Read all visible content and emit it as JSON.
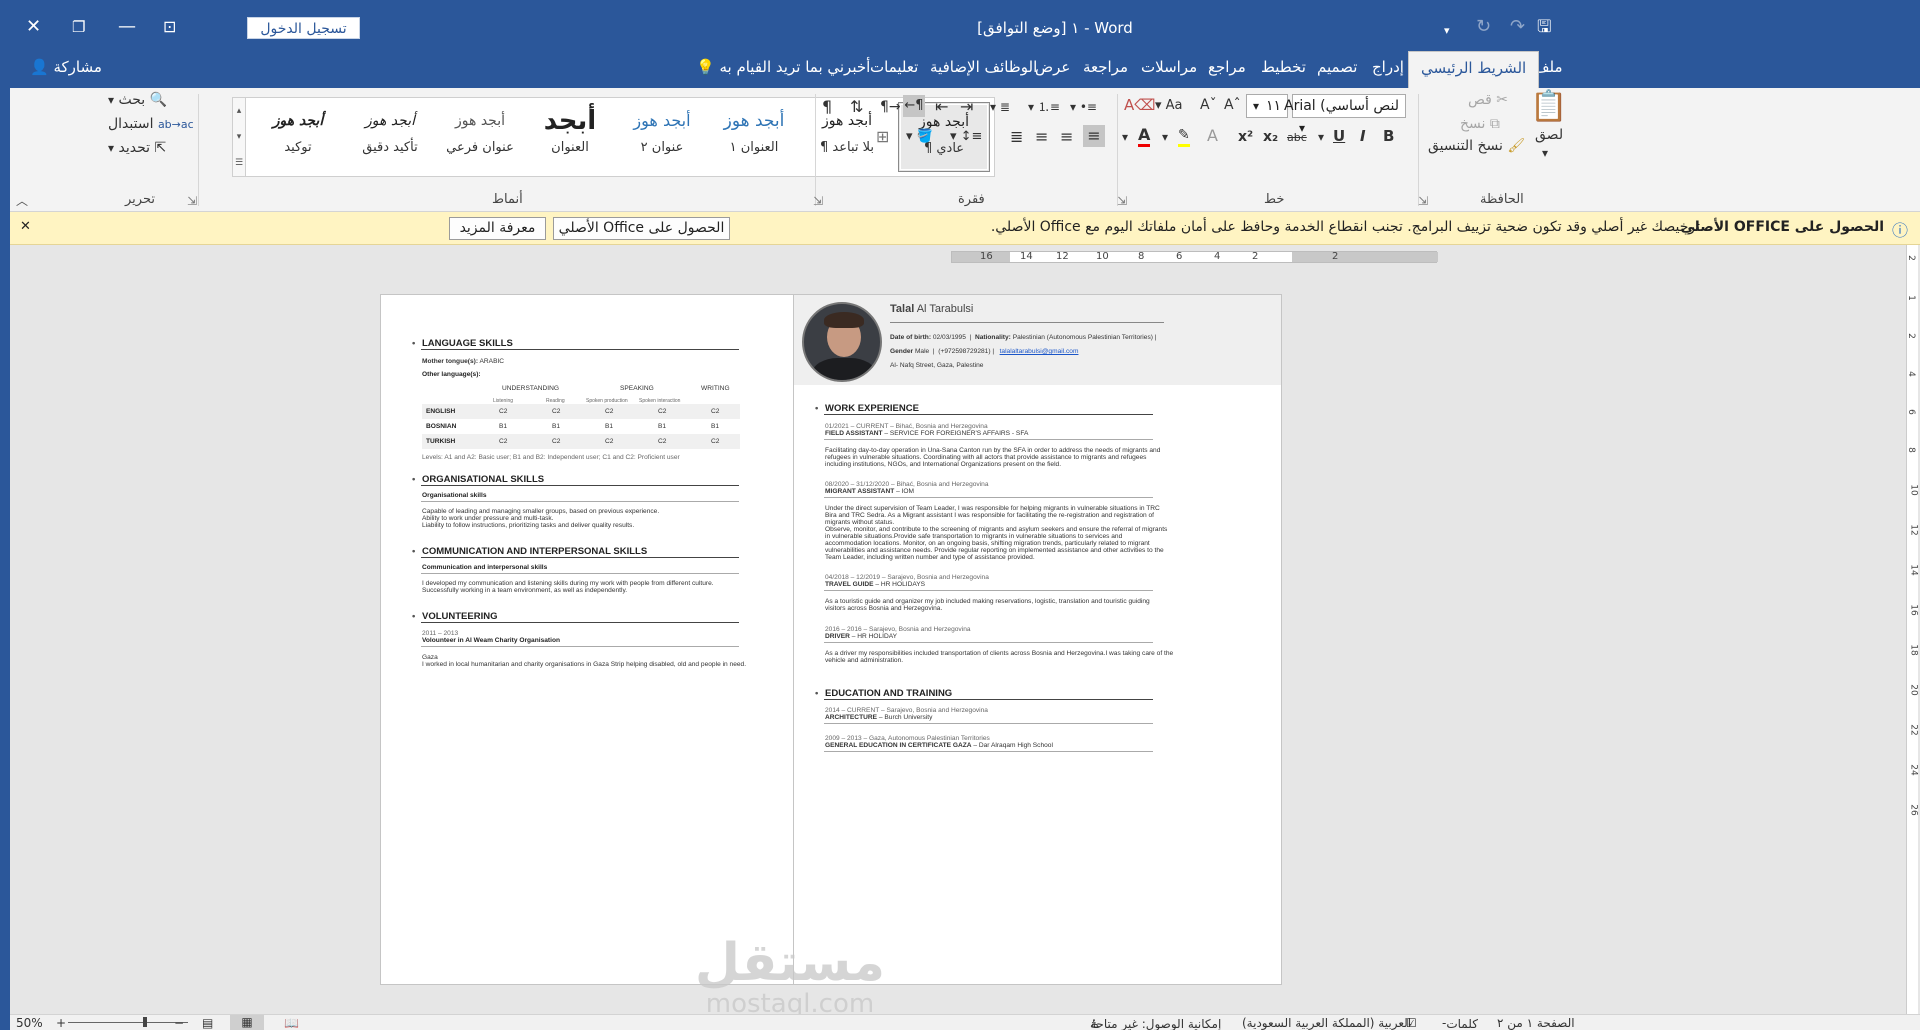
{
  "titlebar": {
    "doc_title": "١ [وضع التوافق] - Word",
    "signin_label": "تسجيل الدخول"
  },
  "menubar": {
    "share_label": "مشاركة",
    "tell_me": "أخبرني بما تريد القيام به",
    "tabs": [
      "ملف",
      "الشريط الرئيسي",
      "إدراج",
      "تصميم",
      "تخطيط",
      "مراجع",
      "مراسلات",
      "مراجعة",
      "عرض",
      "الوظائف الإضافية",
      "تعليمات"
    ]
  },
  "ribbon": {
    "clipboard": {
      "group_label": "الحافظة",
      "paste": "لصق",
      "cut": "قص",
      "copy": "نسخ",
      "format_painter": "نسخ التنسيق"
    },
    "font": {
      "group_label": "خط",
      "font_name": "لنص أساسي) Arial",
      "font_size": "١١"
    },
    "paragraph": {
      "group_label": "فقرة"
    },
    "styles": {
      "group_label": "أنماط",
      "items": [
        {
          "preview": "أبجد هوز",
          "name": "¶ عادي"
        },
        {
          "preview": "أبجد هوز",
          "name": "¶ بلا تباعد"
        },
        {
          "preview": "أبجد هوز",
          "name": "العنوان ١"
        },
        {
          "preview": "أبجد هوز",
          "name": "عنوان ٢"
        },
        {
          "preview": "أبجد",
          "name": "العنوان"
        },
        {
          "preview": "أبجد هوز",
          "name": "عنوان فرعي"
        },
        {
          "preview": "أبجد هوز",
          "name": "تأكيد دقيق"
        },
        {
          "preview": "أبجد هوز",
          "name": "توكيد"
        }
      ]
    },
    "editing": {
      "group_label": "تحرير",
      "find": "بحث",
      "replace": "استبدال",
      "select": "تحديد"
    }
  },
  "notification": {
    "title": "الحصول على OFFICE الأصلي",
    "message": "ترخيصك غير أصلي وقد تكون ضحية تزييف البرامج. تجنب انقطاع الخدمة وحافظ على أمان ملفاتك اليوم مع Office الأصلي.",
    "get_button": "الحصول على Office الأصلي",
    "learn_button": "معرفة المزيد"
  },
  "ruler_labels": [
    "16",
    "14",
    "12",
    "10",
    "8",
    "6",
    "4",
    "2",
    "2"
  ],
  "page_right": {
    "first_name": "Talal",
    "last_name": "Al Tarabulsi",
    "dob_label": "Date of birth:",
    "dob": "02/03/1995",
    "nat_label": "Nationality:",
    "nationality": "Palestinian (Autonomous Palestinian Territories)",
    "gender_label": "Gender",
    "gender": "Male",
    "phone": "(+972598729281)",
    "email": "talalaltarabulsi@gmail.com",
    "address": "Al- Nafq Street, Gaza, Palestine",
    "work_heading": "WORK EXPERIENCE",
    "jobs": [
      {
        "date": "01/2021 – CURRENT – Bihać, Bosnia and Herzegovina",
        "title": "FIELD ASSISTANT",
        "org": "SERVICE FOR FOREIGNER'S AFFAIRS - SFA",
        "lines": [
          "Facilitating day-to-day operation in Una-Sana Canton run by the SFA in order to address the needs of migrants and",
          "refugees in vulnerable situations. Coordinating with all actors that provide assistance to migrants and refugees",
          "including institutions, NGOs, and International Organizations present on the field."
        ]
      },
      {
        "date": "08/2020 – 31/12/2020 – Bihać, Bosnia and Herzegovina",
        "title": "MIGRANT ASSISTANT",
        "org": "IOM",
        "lines": [
          "Under the direct supervision of Team Leader, I was responsible for helping migrants in vulnerable situations in TRC",
          "Bira and TRC Sedra. As a Migrant assistant I was responsible for facilitating the re-registration and registration of",
          "migrants without status.",
          "Observe, monitor, and contribute to the screening of migrants and asylum seekers and ensure the referral of migrants",
          "in vulnerable situations.Provide safe transportation to migrants in vulnerable situations to services and",
          "accommodation locations. Monitor, on an ongoing basis, shifting migration trends, particularly related to migrant",
          "vulnerabilities and assistance needs. Provide regular reporting on implemented assistance and other activities to the",
          "Team Leader, including written number and type of assistance provided."
        ]
      },
      {
        "date": "04/2018 – 12/2019 – Sarajevo, Bosnia and Herzegovina",
        "title": "TRAVEL GUIDE",
        "org": "HR HOLIDAYS",
        "lines": [
          "As a touristic guide and organizer my job included making reservations, logistic, translation and touristic guiding",
          "visitors across Bosnia and Herzegovina."
        ]
      },
      {
        "date": "2016 – 2016 – Sarajevo, Bosnia and Herzegovina",
        "title": "DRIVER",
        "org": "HR HOLIDAY",
        "lines": [
          "As a driver my responsibilities included transportation of clients across Bosnia and Herzegovina.I was taking care of the",
          "vehicle and administration."
        ]
      }
    ],
    "edu_heading": "EDUCATION AND TRAINING",
    "edu": [
      {
        "date": "2014 – CURRENT – Sarajevo, Bosnia and Herzegovina",
        "title": "ARCHITECTURE",
        "org": "Burch University"
      },
      {
        "date": "2009 – 2013 – Gaza, Autonomous Palestinian Territories",
        "title": "GENERAL EDUCATION IN CERTIFICATE GAZA",
        "org": "Dar Alraqam High School"
      }
    ]
  },
  "page_left": {
    "lang_heading": "LANGUAGE SKILLS",
    "mother_label": "Mother tongue(s):",
    "mother": "ARABIC",
    "other_label": "Other language(s):",
    "col_groups": [
      "UNDERSTANDING",
      "SPEAKING",
      "WRITING"
    ],
    "sub_cols": [
      "Listening",
      "Reading",
      "Spoken production",
      "Spoken interaction"
    ],
    "languages": [
      {
        "name": "ENGLISH",
        "levels": [
          "C2",
          "C2",
          "C2",
          "C2",
          "C2"
        ]
      },
      {
        "name": "BOSNIAN",
        "levels": [
          "B1",
          "B1",
          "B1",
          "B1",
          "B1"
        ]
      },
      {
        "name": "TURKISH",
        "levels": [
          "C2",
          "C2",
          "C2",
          "C2",
          "C2"
        ]
      }
    ],
    "levels_note": "Levels: A1 and A2: Basic user; B1 and B2: Independent user; C1 and C2: Proficient user",
    "org_heading": "ORGANISATIONAL SKILLS",
    "org_sub": "Organisational skills",
    "org_lines": [
      "Capable of leading and managing smaller groups, based on previous experience.",
      "Ability to work under pressure and multi-task.",
      "Liability to follow instructions, prioritizing tasks and deliver quality results."
    ],
    "comm_heading": "COMMUNICATION AND INTERPERSONAL SKILLS",
    "comm_sub": "Communication and interpersonal skills",
    "comm_lines": [
      "I developed my communication and listening skills during my work with people from different culture.",
      "Successfully working in a team environment, as well as independently."
    ],
    "vol_heading": "VOLUNTEERING",
    "vol_date": "2011 – 2013",
    "vol_title": "Volounteer in Al Weam Charity Organisation",
    "vol_place": "Gaza",
    "vol_line": "I worked in local humanitarian and charity organisations in Gaza Strip helping disabled, old and people in need."
  },
  "watermark": {
    "arabic": "مستقل",
    "latin": "mostaql.com"
  },
  "statusbar": {
    "page": "الصفحة ١ من ٢",
    "words": "كلمات",
    "lang": "العربية (المملكة العربية السعودية)",
    "access": "إمكانية الوصول: غير متاحة",
    "zoom": "50%"
  }
}
